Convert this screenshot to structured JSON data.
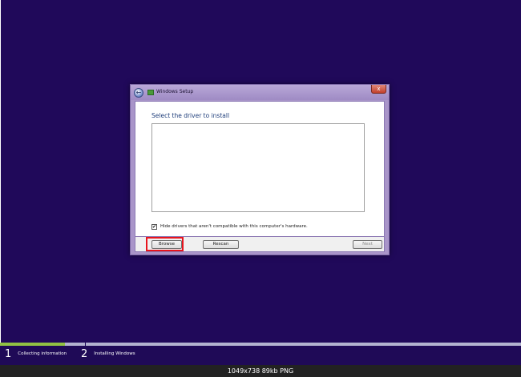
{
  "window": {
    "title": "Windows Setup",
    "close_label": "x",
    "back_label": "←"
  },
  "content": {
    "heading": "Select the driver to install",
    "hide_drivers_checked": true,
    "hide_drivers_label": "Hide drivers that aren't compatible with this computer's hardware."
  },
  "buttons": {
    "browse": "Browse",
    "rescan": "Rescan",
    "next": "Next"
  },
  "progress": {
    "fraction": 0.125,
    "steps": [
      {
        "number": "1",
        "label": "Collecting information"
      },
      {
        "number": "2",
        "label": "Installing Windows"
      }
    ]
  },
  "caption": "1049x738  89kb  PNG",
  "colors": {
    "background": "#20095a",
    "highlight": "#e8141d",
    "progress": "#91c243"
  }
}
